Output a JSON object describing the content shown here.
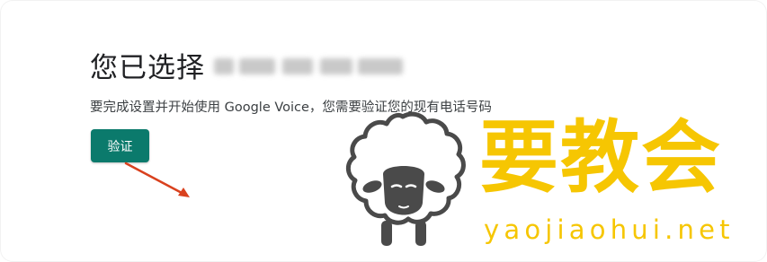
{
  "heading": {
    "prefix": "您已选择"
  },
  "description": "要完成设置并开始使用 Google Voice，您需要验证您的现有电话号码",
  "verify_button": {
    "label": "验证"
  },
  "watermark": {
    "name": "要教会",
    "url": "yaojiaohui.net",
    "icon": "sheep-icon",
    "color": "#f6c602"
  },
  "colors": {
    "button": "#0b7a6c",
    "arrow": "#d9411e",
    "text": "#202124"
  }
}
